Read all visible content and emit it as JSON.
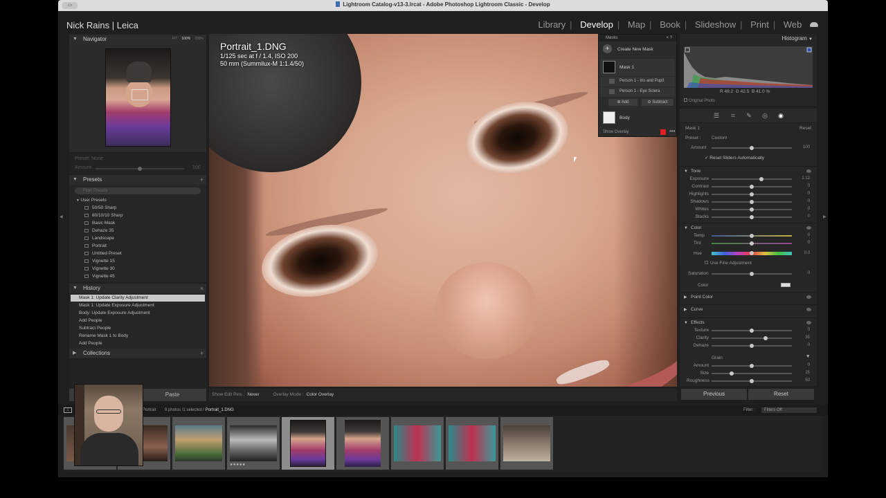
{
  "window": {
    "title": "Lightroom Catalog-v13-3.lrcat - Adobe Photoshop Lightroom Classic - Develop"
  },
  "identity_plate": "Nick Rains | Leica",
  "modules": [
    {
      "label": "Library",
      "active": false
    },
    {
      "label": "Develop",
      "active": true
    },
    {
      "label": "Map",
      "active": false
    },
    {
      "label": "Book",
      "active": false
    },
    {
      "label": "Slideshow",
      "active": false
    },
    {
      "label": "Print",
      "active": false
    },
    {
      "label": "Web",
      "active": false
    }
  ],
  "navigator": {
    "title": "Navigator",
    "zoom": [
      "FIT",
      "100%",
      "200%"
    ]
  },
  "preset_area": {
    "preset": "Preset: None",
    "amount": "Amount",
    "amount_value": "100"
  },
  "presets": {
    "title": "Presets",
    "search_placeholder": "Filter Presets",
    "group": "User Presets",
    "items": [
      "50/50 Sharp",
      "80/10/10 Sharp",
      "Basic Mask",
      "Dehaze 35",
      "Landscape",
      "Portrait",
      "Untitled Preset",
      "Vignette 15",
      "Vignette 30",
      "Vignette 45"
    ]
  },
  "history": {
    "title": "History",
    "items": [
      "Mask 1: Update Clarity Adjustment",
      "Mask 1: Update Exposure Adjustment",
      "Body: Update Exposure Adjustment",
      "Add People",
      "Subtract People",
      "Rename Mask 1 to Body",
      "Add People"
    ]
  },
  "collections": {
    "title": "Collections"
  },
  "paste_label": "Paste",
  "image": {
    "filename": "Portrait_1.DNG",
    "exposure": "1/125 sec at f / 1.4, ISO 200",
    "lens": "50 mm (Summilux-M 1:1.4/50)"
  },
  "masks": {
    "title": "Masks",
    "create_label": "Create New Mask",
    "mask1": "Mask 1",
    "sub1": "Person 1 - Iris and Pupil",
    "sub2": "Person 1 - Eye Sclera",
    "add": "Add",
    "subtract": "Subtract",
    "body": "Body",
    "show_overlay": "Show Overlay",
    "overlay_color": "#e02020"
  },
  "toolbar": {
    "edit_pins_label": "Show Edit Pins :",
    "edit_pins_value": "Never",
    "overlay_label": "Overlay Mode :",
    "overlay_value": "Color Overlay"
  },
  "histogram": {
    "title": "Histogram",
    "r_label": "R",
    "r": "49.2",
    "g_label": "G",
    "g": "42.5",
    "b_label": "B",
    "b": "41.0",
    "pct": "%",
    "original_photo": "Original Photo"
  },
  "mask_panel": {
    "name": "Mask 1",
    "reset": "Reset",
    "preset_label": "Preset :",
    "preset_value": "Custom",
    "amount_label": "Amount",
    "amount_value": "100",
    "reset_sliders": "Reset Sliders Automatically",
    "tone": {
      "title": "Tone",
      "sliders": [
        {
          "label": "Exposure",
          "value": "1.12",
          "pos": 0.62
        },
        {
          "label": "Contrast",
          "value": "0",
          "pos": 0.5
        },
        {
          "label": "Highlights",
          "value": "0",
          "pos": 0.5
        },
        {
          "label": "Shadows",
          "value": "0",
          "pos": 0.5
        },
        {
          "label": "Whites",
          "value": "0",
          "pos": 0.5
        },
        {
          "label": "Blacks",
          "value": "0",
          "pos": 0.5
        }
      ]
    },
    "color": {
      "title": "Color",
      "temp": "Temp",
      "temp_value": "0",
      "tint": "Tint",
      "tint_value": "0",
      "hue": "Hue",
      "hue_value": "0.0",
      "fine": "Use Fine Adjustment",
      "saturation": "Saturation",
      "saturation_value": "0",
      "color_label": "Color"
    },
    "point_color": "Point Color",
    "curve": "Curve",
    "effects": {
      "title": "Effects",
      "sliders": [
        {
          "label": "Texture",
          "value": "0",
          "pos": 0.5
        },
        {
          "label": "Clarity",
          "value": "35",
          "pos": 0.67
        },
        {
          "label": "Dehaze",
          "value": "0",
          "pos": 0.5
        }
      ]
    },
    "grain": {
      "title": "Grain",
      "sliders": [
        {
          "label": "Amount",
          "value": "0",
          "pos": 0.5
        },
        {
          "label": "Size",
          "value": "25",
          "pos": 0.25
        },
        {
          "label": "Roughness",
          "value": "50",
          "pos": 0.5
        }
      ]
    }
  },
  "buttons": {
    "previous": "Previous",
    "reset": "Reset"
  },
  "filmstrip": {
    "source": "Portrait",
    "count": "9 photos /1 selected /",
    "selected_file": "Portrait_1.DNG",
    "filter_label": "Filter :",
    "filter_value": "Filters Off"
  }
}
